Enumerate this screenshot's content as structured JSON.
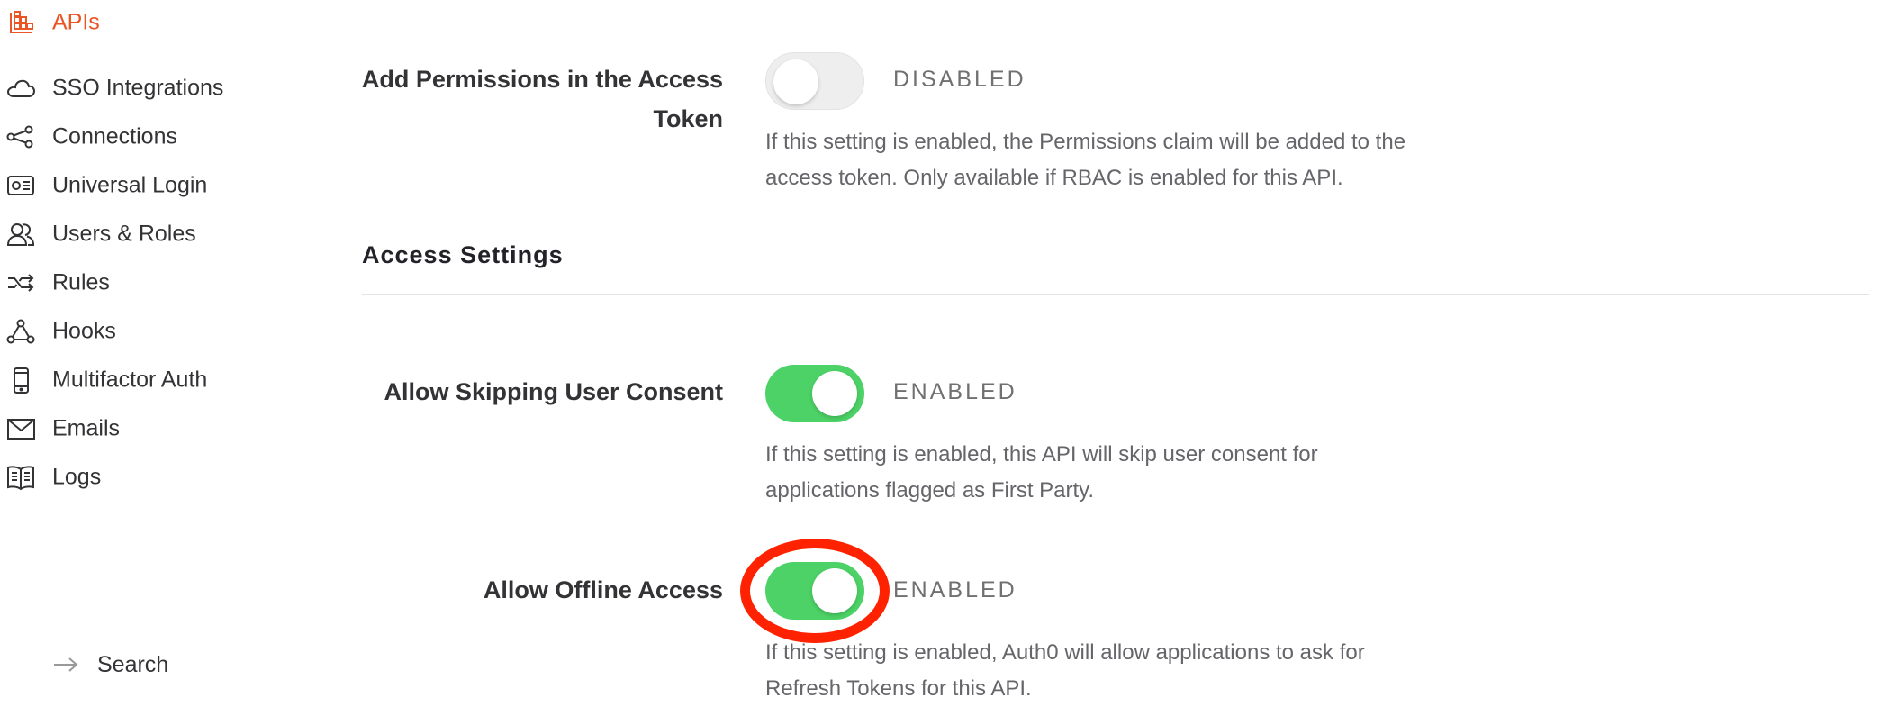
{
  "sidebar": {
    "items": [
      {
        "label": "APIs",
        "icon": "apis-grid-icon",
        "active": true
      },
      {
        "label": "SSO Integrations",
        "icon": "cloud-icon"
      },
      {
        "label": "Connections",
        "icon": "share-nodes-icon"
      },
      {
        "label": "Universal Login",
        "icon": "login-card-icon"
      },
      {
        "label": "Users & Roles",
        "icon": "users-icon"
      },
      {
        "label": "Rules",
        "icon": "shuffle-icon"
      },
      {
        "label": "Hooks",
        "icon": "hooks-icon"
      },
      {
        "label": "Multifactor Auth",
        "icon": "phone-icon"
      },
      {
        "label": "Emails",
        "icon": "envelope-icon"
      },
      {
        "label": "Logs",
        "icon": "book-icon"
      }
    ],
    "sub_items": [
      {
        "label": "Search",
        "icon": "arrow-right-icon"
      }
    ]
  },
  "settings": {
    "add_permissions": {
      "label_line1": "Add Permissions in the Access",
      "label_line2": "Token",
      "state": "DISABLED",
      "enabled": false,
      "description_line1": "If this setting is enabled, the Permissions claim will be added to the",
      "description_line2": "access token. Only available if RBAC is enabled for this API."
    },
    "access_settings_title": "Access Settings",
    "skip_consent": {
      "label": "Allow Skipping User Consent",
      "state": "ENABLED",
      "enabled": true,
      "description_line1": "If this setting is enabled, this API will skip user consent for",
      "description_line2": "applications flagged as First Party."
    },
    "offline_access": {
      "label": "Allow Offline Access",
      "state": "ENABLED",
      "enabled": true,
      "description_line1": "If this setting is enabled, Auth0 will allow applications to ask for",
      "description_line2": "Refresh Tokens for this API."
    }
  },
  "colors": {
    "accent": "#eb5424",
    "toggle_on": "#4cd266",
    "toggle_off": "#eeeeee",
    "highlight": "#ff2200"
  }
}
